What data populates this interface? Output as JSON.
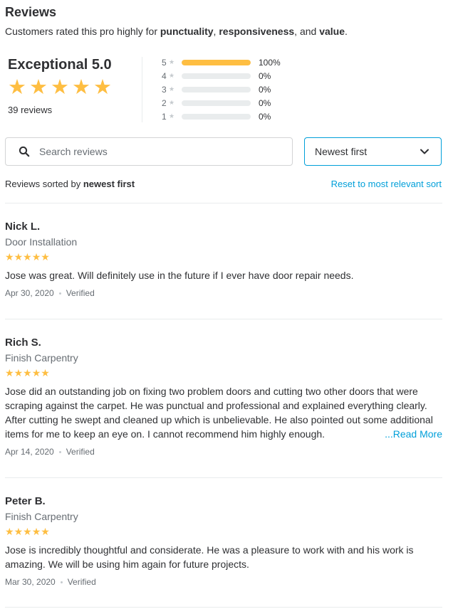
{
  "header": {
    "title": "Reviews",
    "subtitle_prefix": "Customers rated this pro highly for ",
    "quality_1": "punctuality",
    "sep_1": ", ",
    "quality_2": "responsiveness",
    "sep_2": ", and ",
    "quality_3": "value",
    "subtitle_suffix": "."
  },
  "summary": {
    "score_label": "Exceptional 5.0",
    "rating": 5,
    "review_count": "39 reviews",
    "histogram": [
      {
        "stars": "5",
        "percent": "100%",
        "fraction": 1.0
      },
      {
        "stars": "4",
        "percent": "0%",
        "fraction": 0
      },
      {
        "stars": "3",
        "percent": "0%",
        "fraction": 0
      },
      {
        "stars": "2",
        "percent": "0%",
        "fraction": 0
      },
      {
        "stars": "1",
        "percent": "0%",
        "fraction": 0
      }
    ]
  },
  "search": {
    "placeholder": "Search reviews",
    "value": "",
    "icon": "search-icon"
  },
  "sort": {
    "selected": "Newest first",
    "icon": "chevron-down-icon",
    "sorted_by_prefix": "Reviews sorted by ",
    "sorted_by_value": "newest first",
    "reset_label": "Reset to most relevant sort"
  },
  "reviews": [
    {
      "name": "Nick L.",
      "service": "Door Installation",
      "rating": 5,
      "text": "Jose was great. Will definitely use in the future if I ever have door repair needs.",
      "date": "Apr 30, 2020",
      "status": "Verified"
    },
    {
      "name": "Rich S.",
      "service": "Finish Carpentry",
      "rating": 5,
      "text": "Jose did an outstanding job on fixing two problem doors and cutting two other doors that were scraping against the carpet. He was punctual and professional and explained everything clearly. After cutting he swept and cleaned up which is unbelievable. He also pointed out some additional items for me to keep an eye on. I cannot recommend him highly enough.",
      "read_more": "...Read More",
      "date": "Apr 14, 2020",
      "status": "Verified"
    },
    {
      "name": "Peter B.",
      "service": "Finish Carpentry",
      "rating": 5,
      "text": "Jose is incredibly thoughtful and considerate. He was a pleasure to work with and his work is amazing. We will be using him again for future projects.",
      "date": "Mar 30, 2020",
      "status": "Verified"
    }
  ],
  "colors": {
    "star": "#febe42",
    "accent": "#009fd9",
    "text": "#2f3033",
    "muted": "#676d73",
    "track": "#e9eced"
  }
}
